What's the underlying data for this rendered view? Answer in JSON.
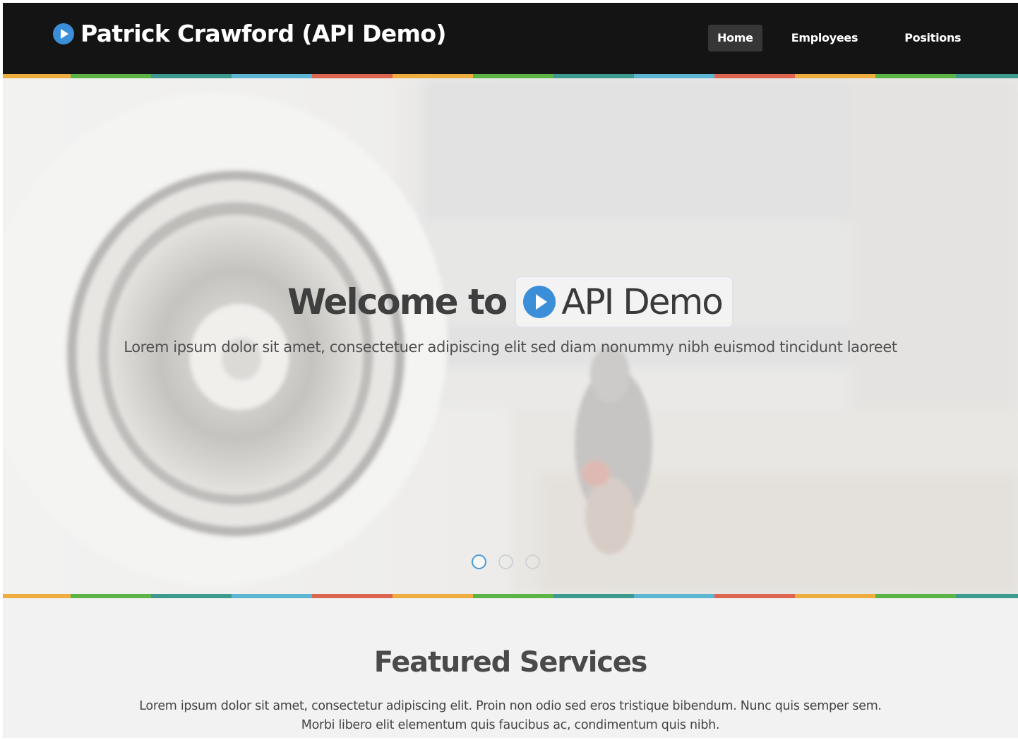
{
  "header": {
    "brand": "Patrick Crawford (API Demo)",
    "brand_icon": "play-circle-icon",
    "nav": [
      {
        "label": "Home",
        "active": true
      },
      {
        "label": "Employees",
        "active": false
      },
      {
        "label": "Positions",
        "active": false
      }
    ]
  },
  "hero": {
    "title_prefix": "Welcome to",
    "logo_text": "API Demo",
    "logo_icon": "play-circle-icon",
    "subtitle": "Lorem ipsum dolor sit amet, consectetuer adipiscing elit sed diam nonummy nibh euismod tincidunt laoreet",
    "carousel_dots": 3,
    "active_slide": 1
  },
  "featured": {
    "title": "Featured Services",
    "text_line1": "Lorem ipsum dolor sit amet, consectetur adipiscing elit. Proin non odio sed eros tristique bibendum. Nunc quis semper sem.",
    "text_line2": "Morbi libero elit elementum quis faucibus ac, condimentum quis nibh."
  },
  "colors": {
    "navbar_bg": "#141414",
    "accent_blue": "#3b8fd9",
    "strip": [
      "#f0ad3f",
      "#5db446",
      "#3d9a8f",
      "#5bb6d3",
      "#dd6650"
    ]
  }
}
